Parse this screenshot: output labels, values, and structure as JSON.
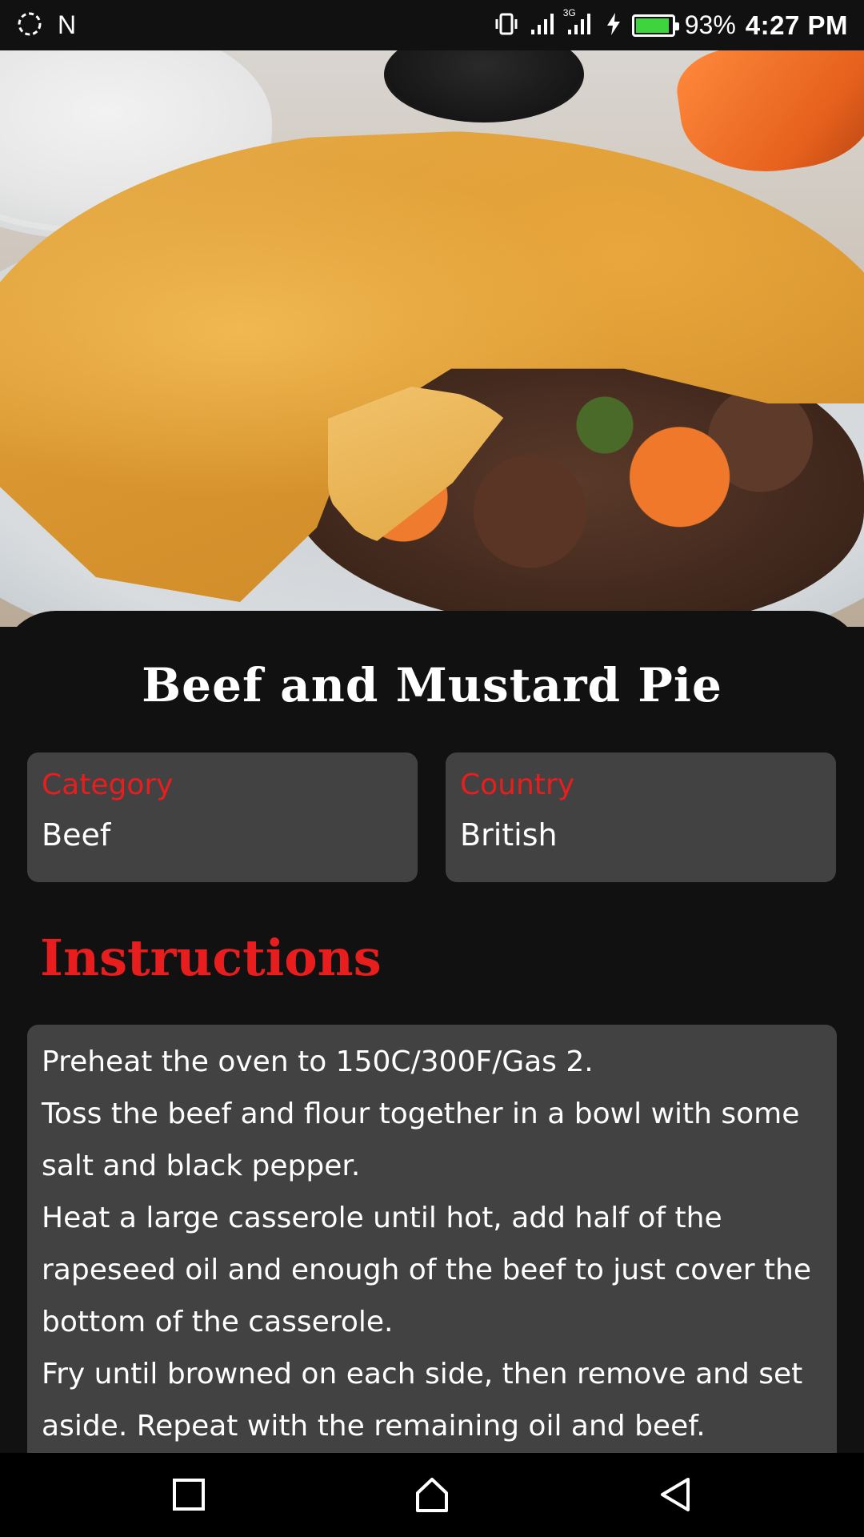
{
  "status_bar": {
    "carrier_mark": "N",
    "battery_percent": "93%",
    "time": "4:27 PM",
    "network_type": "3G",
    "battery_level": 0.93,
    "icons": [
      "sync-icon",
      "n-notification-icon",
      "vibrate-icon",
      "signal-icon",
      "signal-3g-icon",
      "charging-icon",
      "battery-icon"
    ]
  },
  "hero": {
    "image": "beef-and-mustard-pie-photo"
  },
  "meal": {
    "title": "Beef and Mustard Pie",
    "category_label": "Category",
    "category_value": "Beef",
    "country_label": "Country",
    "country_value": "British"
  },
  "instructions": {
    "heading": "Instructions",
    "lines": [
      "Preheat the oven to 150C/300F/Gas 2.",
      "Toss the beef and flour together in a bowl with some salt and black pepper.",
      "Heat a large casserole until hot, add half of the rapeseed oil and enough of the beef to just cover the bottom of the casserole.",
      "Fry until browned on each side, then remove and set aside. Repeat with the remaining oil and beef."
    ]
  },
  "nav_bar": {
    "icons": [
      "recents-icon",
      "home-icon",
      "back-icon"
    ]
  },
  "colors": {
    "accent": "#e81e1e",
    "card_bg": "#424242",
    "background": "#111111"
  }
}
